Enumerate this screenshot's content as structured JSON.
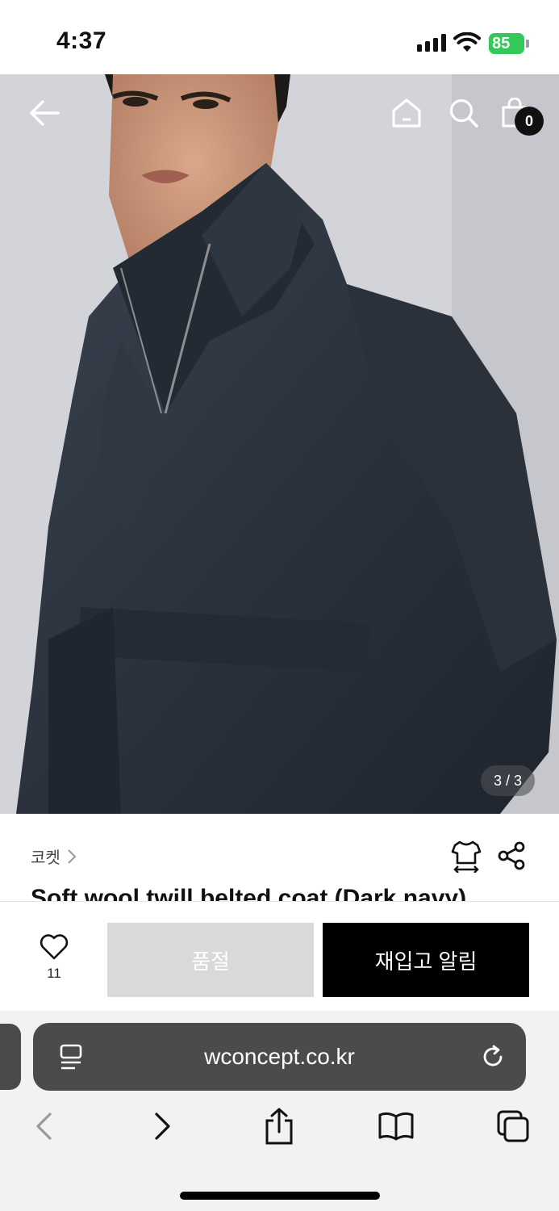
{
  "status_bar": {
    "time": "4:37",
    "battery": "85"
  },
  "product_image": {
    "counter": "3 / 3"
  },
  "header": {
    "cart_count": "0"
  },
  "product": {
    "brand": "코켓",
    "title": "Soft wool twill belted coat (Dark navy)"
  },
  "actions": {
    "like_count": "11",
    "soldout_label": "품절",
    "restock_label": "재입고 알림"
  },
  "browser": {
    "url": "wconcept.co.kr"
  },
  "colors": {
    "battery_green": "#34c759",
    "restock_button": "#000000",
    "soldout_button": "#d9d9d9"
  }
}
